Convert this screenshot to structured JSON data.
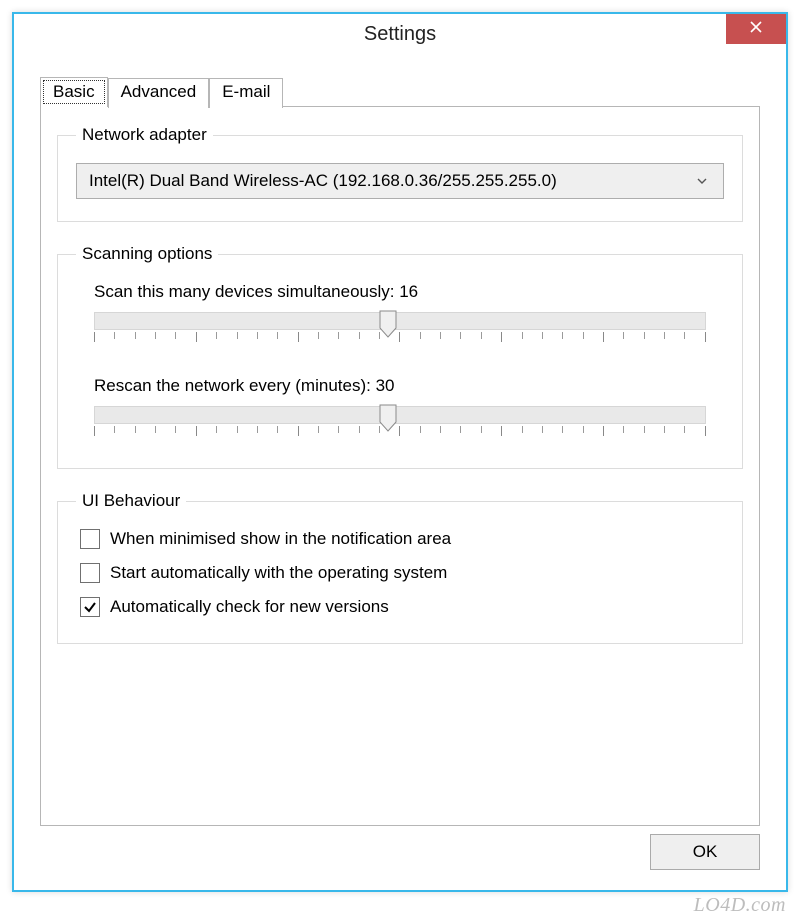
{
  "window": {
    "title": "Settings"
  },
  "tabs": {
    "basic": "Basic",
    "advanced": "Advanced",
    "email": "E-mail"
  },
  "groups": {
    "adapter": {
      "legend": "Network adapter",
      "selected": "Intel(R) Dual Band Wireless-AC (192.168.0.36/255.255.255.0)"
    },
    "scanning": {
      "legend": "Scanning options",
      "simultaneous": {
        "label": "Scan this many devices simultaneously:",
        "value": "16",
        "percent": 48
      },
      "rescan": {
        "label": "Rescan the network every (minutes):",
        "value": "30",
        "percent": 48
      }
    },
    "ui": {
      "legend": "UI Behaviour",
      "opt_tray": {
        "label": "When minimised show in the notification area",
        "checked": false
      },
      "opt_autostart": {
        "label": "Start automatically with the operating system",
        "checked": false
      },
      "opt_update": {
        "label": "Automatically check for new versions",
        "checked": true
      }
    }
  },
  "buttons": {
    "ok": "OK"
  },
  "watermark": "LO4D.com"
}
